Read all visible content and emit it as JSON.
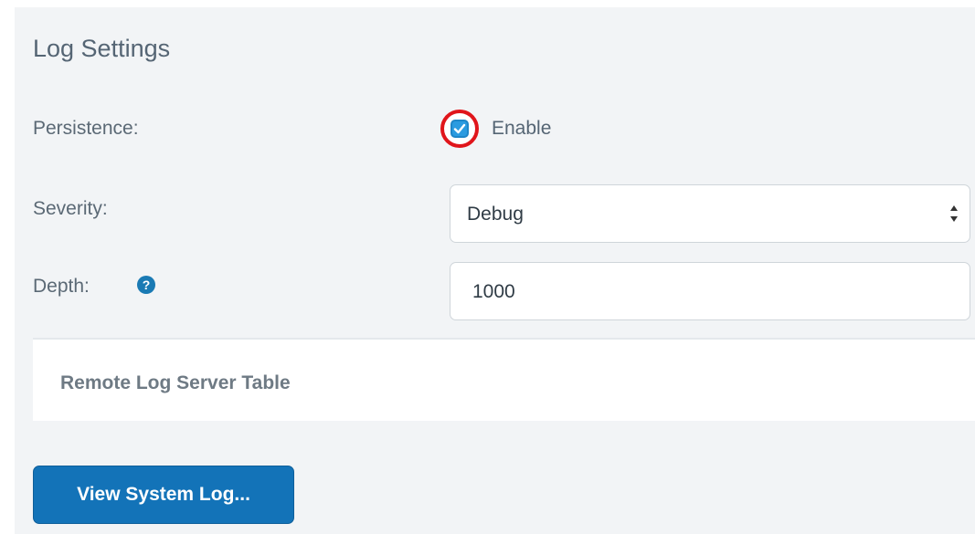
{
  "page_title": "Log Settings",
  "persistence": {
    "label": "Persistence:",
    "checkbox_checked": true,
    "checkbox_label": "Enable",
    "highlight_color": "#e0151b"
  },
  "severity": {
    "label": "Severity:",
    "selected": "Debug"
  },
  "depth": {
    "label": "Depth:",
    "help_icon": "question-circle-icon",
    "value": "1000"
  },
  "remote_log_server_table": {
    "title": "Remote Log Server Table"
  },
  "view_system_log_button": {
    "label": "View System Log...",
    "color": "#1373b8"
  },
  "colors": {
    "panel_background": "#f2f4f6",
    "checkbox_accent": "#2b9be0",
    "help_icon": "#1a7ab4"
  }
}
